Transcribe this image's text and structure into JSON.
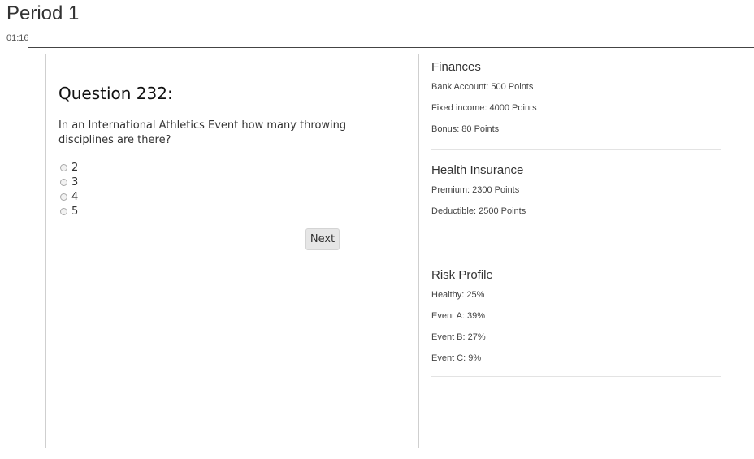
{
  "header": {
    "period_title": "Period 1",
    "timer": "01:16"
  },
  "question": {
    "title": "Question 232:",
    "text": "In an International Athletics Event how many throwing disciplines are there?",
    "options": [
      {
        "label": "2",
        "selected": false
      },
      {
        "label": "3",
        "selected": false
      },
      {
        "label": "4",
        "selected": false
      },
      {
        "label": "5",
        "selected": false
      }
    ],
    "next_label": "Next"
  },
  "finances": {
    "heading": "Finances",
    "items": [
      "Bank Account: 500 Points",
      "Fixed income: 4000 Points",
      "Bonus: 80 Points"
    ]
  },
  "health_insurance": {
    "heading": "Health Insurance",
    "items": [
      "Premium: 2300 Points",
      "Deductible: 2500 Points"
    ]
  },
  "risk_profile": {
    "heading": "Risk Profile",
    "items": [
      "Healthy: 25%",
      "Event A: 39%",
      "Event B: 27%",
      "Event C: 9%"
    ]
  },
  "colors": {
    "button_bg": "#e6e6e6",
    "panel_border": "#cfcfcf",
    "divider": "#e3e3e3"
  }
}
